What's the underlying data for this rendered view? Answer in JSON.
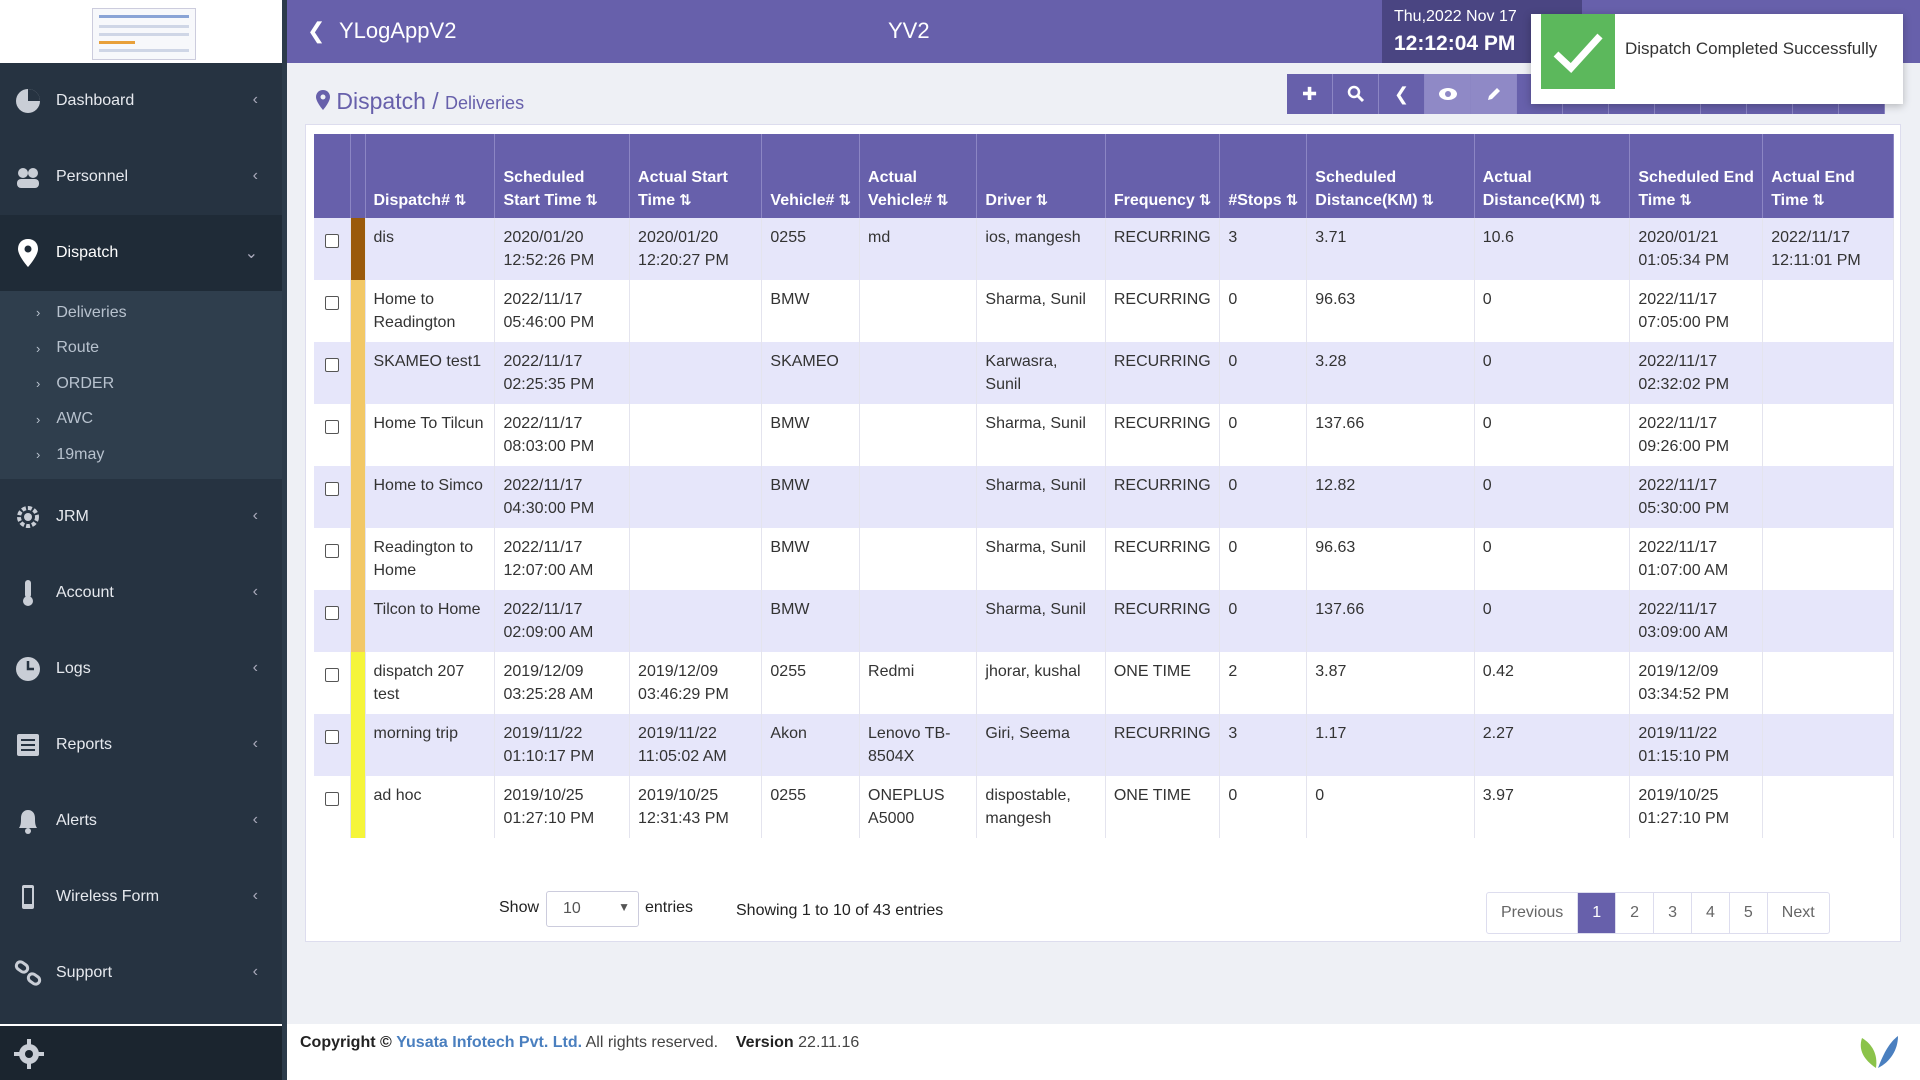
{
  "header": {
    "app_title": "YLogAppV2",
    "center_title": "YV2",
    "date": "Thu,2022 Nov 17",
    "time": "12:12:04 PM"
  },
  "toast": {
    "message": "Dispatch Completed Successfully"
  },
  "breadcrumb": {
    "main": "Dispatch",
    "separator": "/",
    "sub": "Deliveries"
  },
  "sidebar": {
    "items": [
      {
        "label": "Dashboard",
        "icon": "dashboard-icon"
      },
      {
        "label": "Personnel",
        "icon": "personnel-icon"
      },
      {
        "label": "Dispatch",
        "icon": "map-pin-icon"
      },
      {
        "label": "JRM",
        "icon": "gear-icon"
      },
      {
        "label": "Account",
        "icon": "thermometer-icon"
      },
      {
        "label": "Logs",
        "icon": "clock-icon"
      },
      {
        "label": "Reports",
        "icon": "list-icon"
      },
      {
        "label": "Alerts",
        "icon": "bell-icon"
      },
      {
        "label": "Wireless Form",
        "icon": "phone-icon"
      },
      {
        "label": "Support",
        "icon": "link-icon"
      }
    ],
    "dispatch_sub": [
      "Deliveries",
      "Route",
      "ORDER",
      "AWC",
      "19may"
    ]
  },
  "table": {
    "headers": [
      "Dispatch#",
      "Scheduled Start Time",
      "Actual Start Time",
      "Vehicle#",
      "Actual Vehicle#",
      "Driver",
      "Frequency",
      "#Stops",
      "Scheduled Distance(KM)",
      "Actual Distance(KM)",
      "Scheduled End Time",
      "Actual End Time"
    ],
    "rows": [
      {
        "color": "#9a5a0a",
        "cells": [
          "dis",
          "2020/01/20 12:52:26 PM",
          "2020/01/20 12:20:27 PM",
          "0255",
          "md",
          "ios, mangesh",
          "RECURRING",
          "3",
          "3.71",
          "10.6",
          "2020/01/21 01:05:34 PM",
          "2022/11/17 12:11:01 PM"
        ]
      },
      {
        "color": "#f2c866",
        "cells": [
          "Home to Readington",
          "2022/11/17 05:46:00 PM",
          "",
          "BMW",
          "",
          "Sharma, Sunil",
          "RECURRING",
          "0",
          "96.63",
          "0",
          "2022/11/17 07:05:00 PM",
          ""
        ]
      },
      {
        "color": "#f2c866",
        "cells": [
          "SKAMEO test1",
          "2022/11/17 02:25:35 PM",
          "",
          "SKAMEO",
          "",
          "Karwasra, Sunil",
          "RECURRING",
          "0",
          "3.28",
          "0",
          "2022/11/17 02:32:02 PM",
          ""
        ]
      },
      {
        "color": "#f2c866",
        "cells": [
          "Home To Tilcun",
          "2022/11/17 08:03:00 PM",
          "",
          "BMW",
          "",
          "Sharma, Sunil",
          "RECURRING",
          "0",
          "137.66",
          "0",
          "2022/11/17 09:26:00 PM",
          ""
        ]
      },
      {
        "color": "#f2c866",
        "cells": [
          "Home to Simco",
          "2022/11/17 04:30:00 PM",
          "",
          "BMW",
          "",
          "Sharma, Sunil",
          "RECURRING",
          "0",
          "12.82",
          "0",
          "2022/11/17 05:30:00 PM",
          ""
        ]
      },
      {
        "color": "#f2c866",
        "cells": [
          "Readington to Home",
          "2022/11/17 12:07:00 AM",
          "",
          "BMW",
          "",
          "Sharma, Sunil",
          "RECURRING",
          "0",
          "96.63",
          "0",
          "2022/11/17 01:07:00 AM",
          ""
        ]
      },
      {
        "color": "#f2c866",
        "cells": [
          "Tilcon to Home",
          "2022/11/17 02:09:00 AM",
          "",
          "BMW",
          "",
          "Sharma, Sunil",
          "RECURRING",
          "0",
          "137.66",
          "0",
          "2022/11/17 03:09:00 AM",
          ""
        ]
      },
      {
        "color": "#f5f53a",
        "cells": [
          "dispatch 207 test",
          "2019/12/09 03:25:28 AM",
          "2019/12/09 03:46:29 PM",
          "0255",
          "Redmi",
          "jhorar, kushal",
          "ONE TIME",
          "2",
          "3.87",
          "0.42",
          "2019/12/09 03:34:52 PM",
          ""
        ]
      },
      {
        "color": "#f5f53a",
        "cells": [
          "morning trip",
          "2019/11/22 01:10:17 PM",
          "2019/11/22 11:05:02 AM",
          "Akon",
          "Lenovo TB-8504X",
          "Giri, Seema",
          "RECURRING",
          "3",
          "1.17",
          "2.27",
          "2019/11/22 01:15:10 PM",
          ""
        ]
      },
      {
        "color": "#f5f53a",
        "cells": [
          "ad hoc",
          "2019/10/25 01:27:10 PM",
          "2019/10/25 12:31:43 PM",
          "0255",
          "ONEPLUS A5000",
          "dispostable, mangesh",
          "ONE TIME",
          "0",
          "0",
          "3.97",
          "2019/10/25 01:27:10 PM",
          ""
        ]
      }
    ]
  },
  "table_footer": {
    "show_label": "Show",
    "page_size": "10",
    "entries_label": "entries",
    "info": "Showing 1 to 10 of 43 entries"
  },
  "pagination": {
    "previous": "Previous",
    "pages": [
      "1",
      "2",
      "3",
      "4",
      "5"
    ],
    "next": "Next",
    "current": "1"
  },
  "footer": {
    "copyright": "Copyright ©",
    "company": "Yusata Infotech Pvt. Ltd.",
    "rights": "All rights reserved.",
    "version_label": "Version",
    "version": "22.11.16"
  }
}
